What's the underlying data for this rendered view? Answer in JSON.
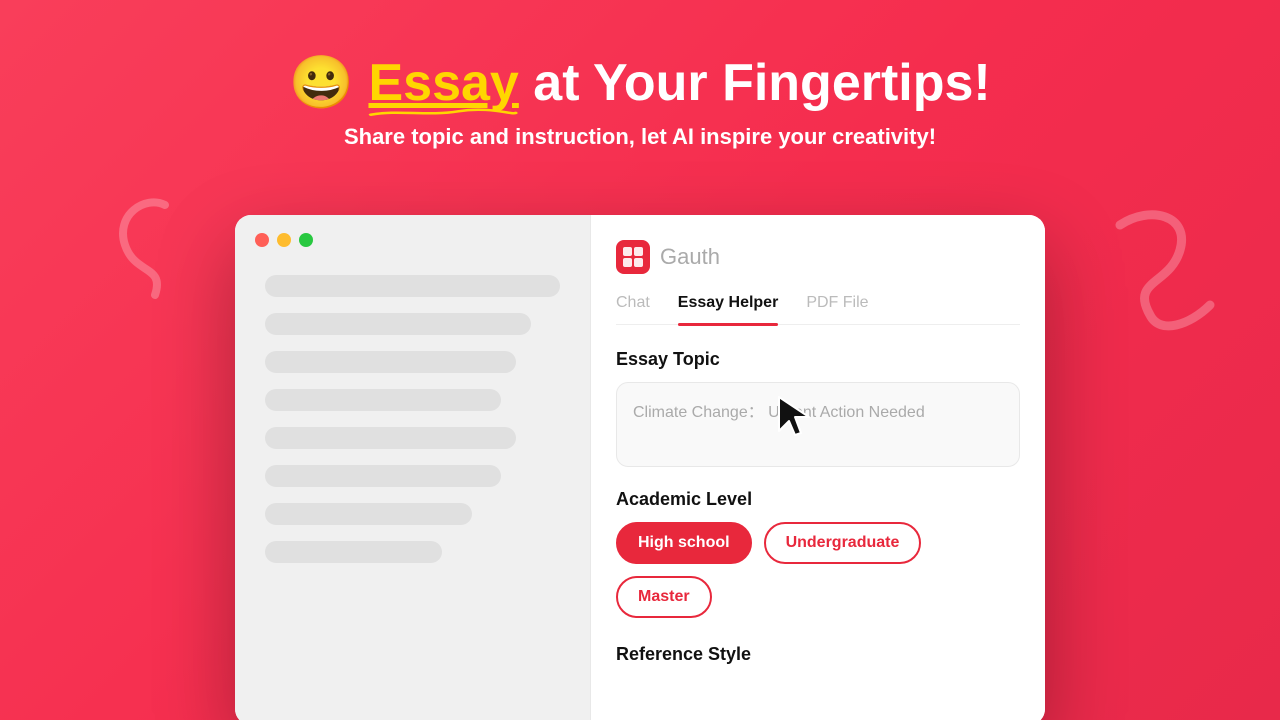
{
  "header": {
    "emoji": "😀",
    "title_part1": "Essay",
    "title_part2": " at Your Fingertips!",
    "subtitle": "Share topic and instruction, let AI inspire your creativity!"
  },
  "window": {
    "titlebar": {
      "lights": [
        "red",
        "yellow",
        "green"
      ]
    }
  },
  "sidebar": {
    "skeletons": [
      {
        "width": "full"
      },
      {
        "width": "90"
      },
      {
        "width": "85"
      },
      {
        "width": "80"
      },
      {
        "width": "85"
      },
      {
        "width": "80"
      },
      {
        "width": "70"
      },
      {
        "width": "60"
      }
    ]
  },
  "main": {
    "logo_text": "GG",
    "app_name": "Gauth",
    "tabs": [
      {
        "label": "Chat",
        "active": false
      },
      {
        "label": "Essay Helper",
        "active": true
      },
      {
        "label": "PDF File",
        "active": false
      }
    ],
    "essay_topic": {
      "label": "Essay Topic",
      "placeholder": "Climate Change： Urgent Action Needed"
    },
    "academic_level": {
      "label": "Academic Level",
      "options": [
        {
          "label": "High school",
          "active": true
        },
        {
          "label": "Undergraduate",
          "active": false
        },
        {
          "label": "Master",
          "active": false
        }
      ]
    },
    "reference_style": {
      "label": "Reference Style"
    }
  }
}
